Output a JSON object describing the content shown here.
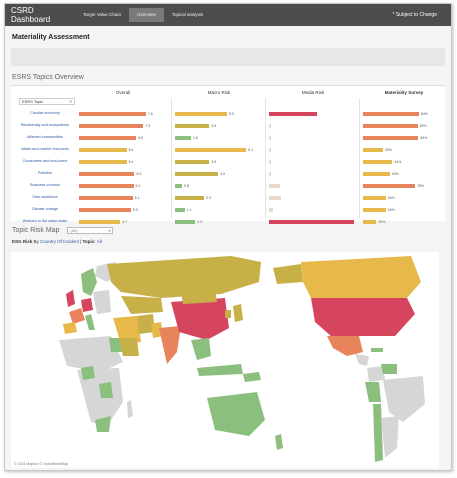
{
  "app": {
    "title": "CSRD Dashboard",
    "notice": "* Subject to Change"
  },
  "nav": {
    "tabs": [
      {
        "label": "Target Value Chain",
        "active": false
      },
      {
        "label": "Overview",
        "active": true
      },
      {
        "label": "Topical analysis",
        "active": false
      }
    ]
  },
  "page": {
    "title": "Materiality Assessment"
  },
  "topics": {
    "section_title": "ESRS Topics Overview",
    "topic_header": "ESRS Topic",
    "columns": [
      "Overall",
      "Macro Risk",
      "Media Risk",
      "Materiality Survey"
    ],
    "rows": [
      {
        "label": "Circular economy",
        "overall": 7.6,
        "macro": 5.9,
        "media": 0.55,
        "survey": 0.84
      },
      {
        "label": "Biodiversity and ecosystems",
        "overall": 7.3,
        "macro": 3.9,
        "media": 0.02,
        "survey": 0.82
      },
      {
        "label": "Affected communities",
        "overall": 6.5,
        "macro": 1.8,
        "media": 0.02,
        "survey": 0.83
      },
      {
        "label": "Water and marine resources",
        "overall": 5.4,
        "macro": 8.1,
        "media": 0.02,
        "survey": 0.3
      },
      {
        "label": "Consumers and end-users",
        "overall": 5.4,
        "macro": 3.9,
        "media": 0.02,
        "survey": 0.44
      },
      {
        "label": "Pollution",
        "overall": 6.3,
        "macro": 4.9,
        "media": 0.02,
        "survey": 0.4
      },
      {
        "label": "Business conduct",
        "overall": 6.2,
        "macro": 0.8,
        "media": 0.12,
        "survey": 0.78
      },
      {
        "label": "Own workforce",
        "overall": 6.1,
        "macro": 3.3,
        "media": 0.14,
        "survey": 0.34
      },
      {
        "label": "Climate change",
        "overall": 5.9,
        "macro": 1.1,
        "media": 0.05,
        "survey": 0.34
      },
      {
        "label": "Workers in the value chain",
        "overall": 4.7,
        "macro": 2.3,
        "media": 0.97,
        "survey": 0.2
      }
    ],
    "overall_labels": [
      "7.6",
      "7.3",
      "6.5",
      "5.4",
      "5.4",
      "6.3",
      "6.2",
      "6.1",
      "5.9",
      "4.7"
    ],
    "macro_labels": [
      "5.9",
      "3.9",
      "1.8",
      "8.1",
      "3.9",
      "4.9",
      "0.8",
      "3.3",
      "1.1",
      "2.3"
    ],
    "survey_labels": [
      "84%",
      "82%",
      "83%",
      "30%",
      "44%",
      "40%",
      "78%",
      "34%",
      "34%",
      "20%"
    ]
  },
  "map": {
    "title": "Topic Risk Map",
    "select_value": "(All)",
    "risk_prefix": "ESG Risk",
    "by_label": "By",
    "dimension": "Country Of Incident",
    "topic_label": "Topic:",
    "topic_value": "All",
    "copyright": "© 2024 Mapbox © OpenStreetMap"
  },
  "colors": {
    "red": "#d6455e",
    "orange": "#e8845c",
    "yellow": "#e7b84a",
    "olive": "#c8b049",
    "green": "#8bbf7e",
    "grey": "#d6d6d6",
    "dark": "#4d4d4d"
  }
}
